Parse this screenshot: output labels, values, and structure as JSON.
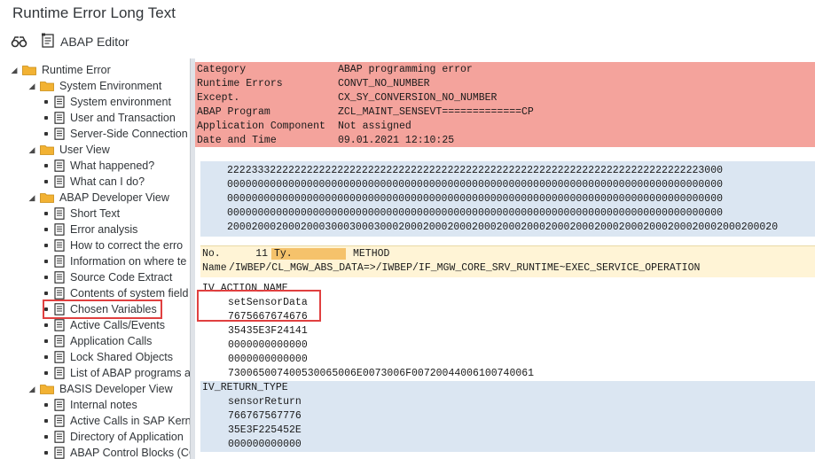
{
  "window": {
    "title": "Runtime Error Long Text"
  },
  "toolbar": {
    "abap_editor_label": "ABAP Editor"
  },
  "tree": {
    "items": [
      {
        "level": 0,
        "type": "folder",
        "label": "Runtime Error"
      },
      {
        "level": 1,
        "type": "folder",
        "label": "System Environment"
      },
      {
        "level": 2,
        "type": "doc",
        "label": "System environment"
      },
      {
        "level": 2,
        "type": "doc",
        "label": "User and Transaction"
      },
      {
        "level": 2,
        "type": "doc",
        "label": "Server-Side Connection"
      },
      {
        "level": 1,
        "type": "folder",
        "label": "User View"
      },
      {
        "level": 2,
        "type": "doc",
        "label": "What happened?"
      },
      {
        "level": 2,
        "type": "doc",
        "label": "What can I do?"
      },
      {
        "level": 1,
        "type": "folder",
        "label": "ABAP Developer View"
      },
      {
        "level": 2,
        "type": "doc",
        "label": "Short Text"
      },
      {
        "level": 2,
        "type": "doc",
        "label": "Error analysis"
      },
      {
        "level": 2,
        "type": "doc",
        "label": "How to correct the erro"
      },
      {
        "level": 2,
        "type": "doc",
        "label": "Information on where te"
      },
      {
        "level": 2,
        "type": "doc",
        "label": "Source Code Extract"
      },
      {
        "level": 2,
        "type": "doc",
        "label": "Contents of system field"
      },
      {
        "level": 2,
        "type": "doc",
        "label": "Chosen Variables"
      },
      {
        "level": 2,
        "type": "doc",
        "label": "Active Calls/Events"
      },
      {
        "level": 2,
        "type": "doc",
        "label": "Application Calls"
      },
      {
        "level": 2,
        "type": "doc",
        "label": "Lock Shared Objects"
      },
      {
        "level": 2,
        "type": "doc",
        "label": "List of ABAP programs a"
      },
      {
        "level": 1,
        "type": "folder",
        "label": "BASIS Developer View"
      },
      {
        "level": 2,
        "type": "doc",
        "label": "Internal notes"
      },
      {
        "level": 2,
        "type": "doc",
        "label": "Active Calls in SAP Kerne"
      },
      {
        "level": 2,
        "type": "doc",
        "label": "Directory of Application"
      },
      {
        "level": 2,
        "type": "doc",
        "label": "ABAP Control Blocks (CC"
      }
    ],
    "selected_label": "Chosen Variables"
  },
  "header": {
    "rows": [
      {
        "key": "Category",
        "value": "ABAP programming error"
      },
      {
        "key": "Runtime Errors",
        "value": "CONVT_NO_NUMBER"
      },
      {
        "key": "Except.",
        "value": "CX_SY_CONVERSION_NO_NUMBER"
      },
      {
        "key": "ABAP Program",
        "value": "ZCL_MAINT_SENSEVT=============CP"
      },
      {
        "key": "Application Component",
        "value": "Not assigned"
      },
      {
        "key": "Date and Time",
        "value": "09.01.2021 12:10:25"
      }
    ]
  },
  "dump": {
    "lines": [
      "222233322222222222222222222222222222222222222222222222222222222222222222222223000",
      "000000000000000000000000000000000000000000000000000000000000000000000000000000000",
      "000000000000000000000000000000000000000000000000000000000000000000000000000000000",
      "000000000000000000000000000000000000000000000000000000000000000000000000000000000",
      "200020002000200030003000300020002000200020002000200020002000200020002000200020002000200020"
    ]
  },
  "call": {
    "no_label": "No.",
    "no_value": "11",
    "ty_label": "Ty.",
    "ty_value": "METHOD",
    "name_label": "Name",
    "name_value": "/IWBEP/CL_MGW_ABS_DATA=>/IWBEP/IF_MGW_CORE_SRV_RUNTIME~EXEC_SERVICE_OPERATION"
  },
  "variables": [
    {
      "name": "IV_ACTION_NAME",
      "lines": [
        "setSensorData",
        "7675667674676",
        "35435E3F24141",
        "0000000000000",
        "0000000000000",
        "730065007400530065006E0073006F00720044006100740061"
      ]
    },
    {
      "name": "IV_RETURN_TYPE",
      "lines": [
        "sensorReturn",
        "766767567776",
        "35E3F225452E",
        "000000000000"
      ]
    }
  ]
}
